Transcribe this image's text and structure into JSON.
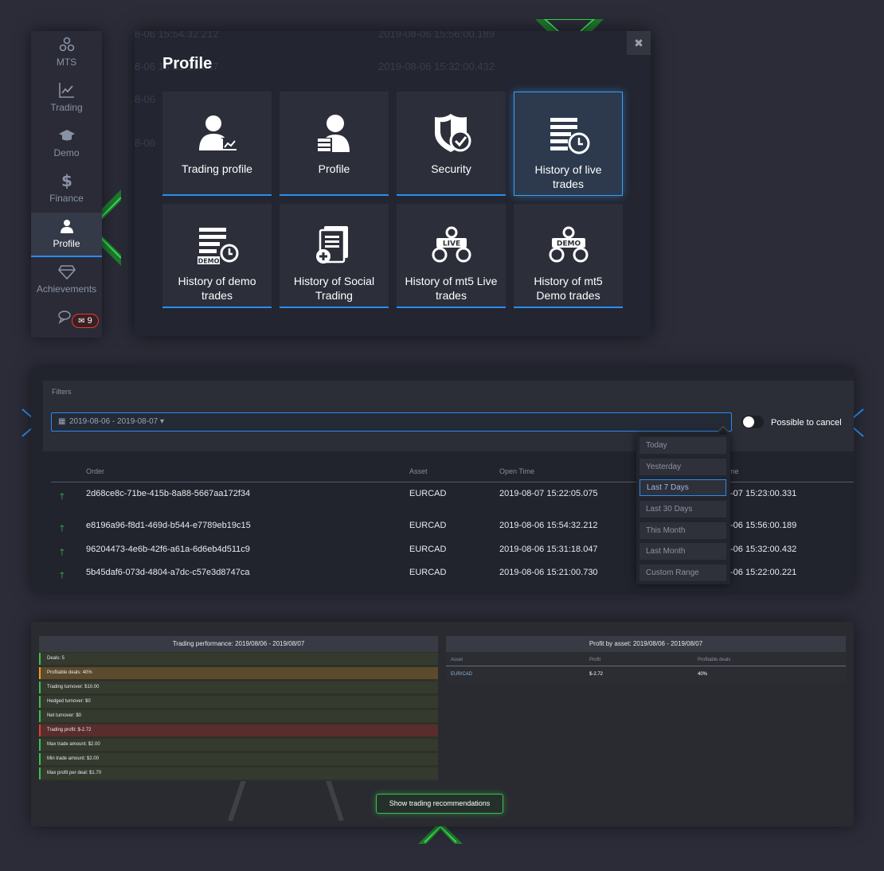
{
  "sidebar": {
    "items": [
      {
        "label": "MTS",
        "icon": "mts-icon"
      },
      {
        "label": "Trading",
        "icon": "chart-line-icon"
      },
      {
        "label": "Demo",
        "icon": "graduation-cap-icon"
      },
      {
        "label": "Finance",
        "icon": "dollar-icon"
      },
      {
        "label": "Profile",
        "icon": "user-icon",
        "active": true
      },
      {
        "label": "Achievements",
        "icon": "diamond-icon"
      }
    ],
    "chat_icon": "chat-bubbles-icon",
    "mail_count": "9"
  },
  "profile_modal": {
    "title": "Profile",
    "close_icon": "close-icon",
    "background_timestamps": [
      "8-06 15:54:32.212",
      "2019-08-06 15:56:00.189",
      "8-06 15:31:18.047",
      "2019-08-06 15:32:00.432",
      "8-06",
      "8-06"
    ],
    "tiles": [
      {
        "label": "Trading profile",
        "icon": "trading-profile-icon"
      },
      {
        "label": "Profile",
        "icon": "profile-list-icon"
      },
      {
        "label": "Security",
        "icon": "shield-check-icon"
      },
      {
        "label": "History of live trades",
        "icon": "history-live-icon",
        "active": true
      },
      {
        "label": "History of demo trades",
        "icon": "history-demo-icon"
      },
      {
        "label": "History of Social Trading",
        "icon": "social-trading-icon"
      },
      {
        "label": "History of mt5 Live trades",
        "icon": "mt5-live-icon"
      },
      {
        "label": "History of mt5 Demo trades",
        "icon": "mt5-demo-icon"
      }
    ]
  },
  "trades": {
    "filters_label": "Filters",
    "date_range": "2019-08-06 - 2019-08-07",
    "toggle_label": "Possible to cancel",
    "columns": [
      "Order",
      "Asset",
      "Open Time",
      "me"
    ],
    "rows": [
      {
        "order": "2d68ce8c-71be-415b-8a88-5667aa172f34",
        "asset": "EURCAD",
        "open": "2019-08-07 15:22:05.075",
        "close": "-07 15:23:00.331"
      },
      {
        "order": "e8196a96-f8d1-469d-b544-e7789eb19c15",
        "asset": "EURCAD",
        "open": "2019-08-06 15:54:32.212",
        "close": "-06 15:56:00.189"
      },
      {
        "order": "96204473-4e6b-42f6-a61a-6d6eb4d511c9",
        "asset": "EURCAD",
        "open": "2019-08-06 15:31:18.047",
        "close": "-06 15:32:00.432"
      },
      {
        "order": "5b45daf6-073d-4804-a7dc-c57e3d8747ca",
        "asset": "EURCAD",
        "open": "2019-08-06 15:21:00.730",
        "close": "-06 15:22:00.221"
      }
    ],
    "range_options": [
      "Today",
      "Yesterday",
      "Last 7 Days",
      "Last 30 Days",
      "This Month",
      "Last Month",
      "Custom Range"
    ],
    "selected_range": "Last 7 Days"
  },
  "performance": {
    "title": "Trading performance: 2019/08/06 - 2019/08/07",
    "stats": [
      {
        "label": "Deals: 5",
        "tone": "green"
      },
      {
        "label": "Profitable deals: 40%",
        "tone": "orange"
      },
      {
        "label": "Trading turnover: $10.00",
        "tone": "green"
      },
      {
        "label": "Hedged turnover: $0",
        "tone": "green"
      },
      {
        "label": "Net turnover: $0",
        "tone": "green"
      },
      {
        "label": "Trading profit: $-2.72",
        "tone": "red"
      },
      {
        "label": "Max trade amount: $2.00",
        "tone": "green"
      },
      {
        "label": "Min trade amount: $2.00",
        "tone": "green"
      },
      {
        "label": "Max profit per deal: $1.70",
        "tone": "green"
      }
    ],
    "by_asset_title": "Profit by asset: 2019/08/06 - 2019/08/07",
    "by_asset_columns": [
      "Asset",
      "Profit",
      "Profitable deals"
    ],
    "by_asset_rows": [
      {
        "asset": "EUR/CAD",
        "profit": "$-2.72",
        "profitable": "40%"
      }
    ],
    "reco_button": "Show trading recommendations"
  },
  "colors": {
    "accent_blue": "#2b8cf0",
    "accent_green": "#36c44f",
    "loss_red": "#e83b2f",
    "warn_orange": "#f0a21e"
  }
}
